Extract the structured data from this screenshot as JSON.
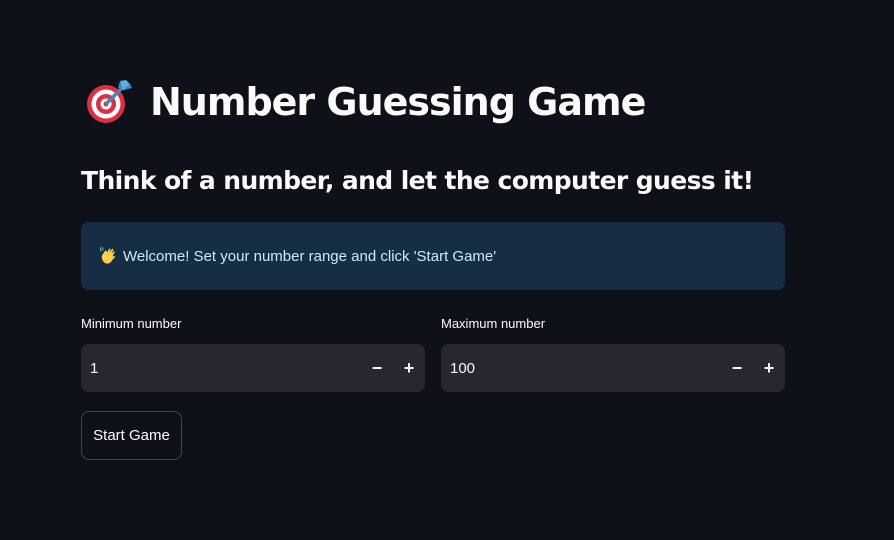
{
  "header": {
    "icon": "direct-hit-target-icon",
    "title": "Number Guessing Game",
    "subtitle": "Think of a number, and let the computer guess it!"
  },
  "info": {
    "icon": "waving-hand-icon",
    "message": "Welcome! Set your number range and click 'Start Game'"
  },
  "inputs": {
    "min": {
      "label": "Minimum number",
      "value": "1",
      "decrement": "−",
      "increment": "+"
    },
    "max": {
      "label": "Maximum number",
      "value": "100",
      "decrement": "−",
      "increment": "+"
    }
  },
  "actions": {
    "start_label": "Start Game"
  },
  "colors": {
    "background": "#0e1117",
    "info_background": "#172d43",
    "info_text": "#c7ebff",
    "input_background": "#262730",
    "text": "#fafafa"
  }
}
